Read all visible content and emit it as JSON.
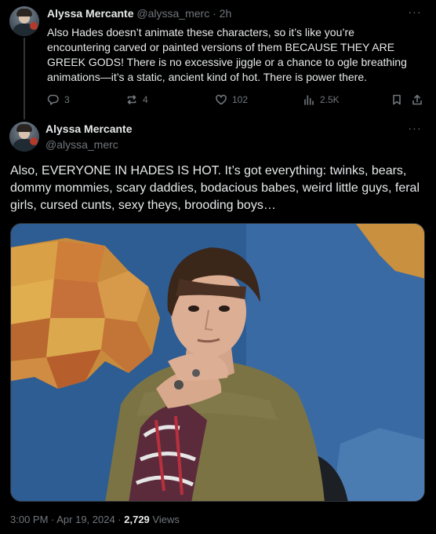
{
  "reply_tweet": {
    "author_name": "Alyssa Mercante",
    "author_handle": "@alyssa_merc",
    "separator": "·",
    "time": "2h",
    "text": "Also Hades doesn’t animate these characters, so it’s like you’re encountering carved or painted versions of them BECAUSE THEY ARE GREEK GODS! There is no excessive jiggle or a chance to ogle breathing animations—it’s a static, ancient kind of hot. There is power there.",
    "stats": {
      "replies": "3",
      "reposts": "4",
      "likes": "102",
      "views": "2.5K"
    }
  },
  "main_tweet": {
    "author_name": "Alyssa Mercante",
    "author_handle": "@alyssa_merc",
    "text": "Also, EVERYONE IN HADES IS HOT. It’s got everything: twinks, bears, dommy mommies, scary daddies, bodacious babes, weird little guys, feral girls, cursed cunts, sexy theys, brooding boys…",
    "timestamp": "3:00 PM · Apr 19, 2024 · ",
    "views_count": "2,729",
    "views_label": " Views"
  },
  "colors": {
    "background": "#000000",
    "text_primary": "#e7e9ea",
    "text_secondary": "#71767b",
    "divider": "#2f3336"
  },
  "icons": [
    "reply-icon",
    "repost-icon",
    "like-icon",
    "views-icon",
    "bookmark-icon",
    "share-icon",
    "more-icon"
  ]
}
